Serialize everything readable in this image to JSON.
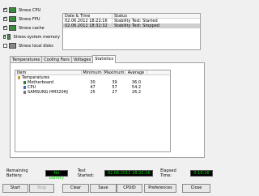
{
  "stress_options": [
    {
      "label": "Stress CPU",
      "checked": true,
      "icon": "cpu-icon"
    },
    {
      "label": "Stress FPU",
      "checked": true,
      "icon": "fpu-icon"
    },
    {
      "label": "Stress cache",
      "checked": true,
      "icon": "cache-icon"
    },
    {
      "label": "Stress system memory",
      "checked": true,
      "icon": "memory-icon"
    },
    {
      "label": "Stress local disks",
      "checked": false,
      "icon": "disk-icon"
    }
  ],
  "log": {
    "headers": {
      "datetime": "Date & Time",
      "status": "Status"
    },
    "rows": [
      {
        "datetime": "02.06.2012 18:22:16",
        "status": "Stability Test: Started"
      },
      {
        "datetime": "02.06.2012 18:32:32",
        "status": "Stability Test: Stopped"
      }
    ]
  },
  "tabs": [
    "Temperatures",
    "Cooling Fans",
    "Voltages",
    "Statistics"
  ],
  "active_tab": "Statistics",
  "stats": {
    "headers": {
      "item": "Item",
      "minimum": "Minimum",
      "maximum": "Maximum",
      "average": "Average"
    },
    "group": "Temperatures",
    "rows": [
      {
        "item": "Motherboard",
        "icon": "motherboard-icon",
        "minimum": "30",
        "maximum": "39",
        "average": "36.0"
      },
      {
        "item": "CPU",
        "icon": "cpu-chip-icon",
        "minimum": "47",
        "maximum": "57",
        "average": "54.2"
      },
      {
        "item": "SAMSUNG HM320HJ",
        "icon": "drive-icon",
        "minimum": "25",
        "maximum": "27",
        "average": "26.2"
      }
    ]
  },
  "status_bar": {
    "remaining_battery_label": "Remaining Battery:",
    "remaining_battery_value": "No battery",
    "test_started_label": "Test Started:",
    "test_started_value": "02.06.2012 18:22:16",
    "elapsed_time_label": "Elapsed Time:",
    "elapsed_time_value": "0:10:16"
  },
  "buttons": {
    "start": "Start",
    "stop": "Stop",
    "clear": "Clear",
    "save": "Save",
    "cpuid": "CPUID",
    "preferences": "Preferences",
    "close": "Close"
  },
  "colors": {
    "status_text": "#00e000",
    "status_bg": "#000000"
  }
}
